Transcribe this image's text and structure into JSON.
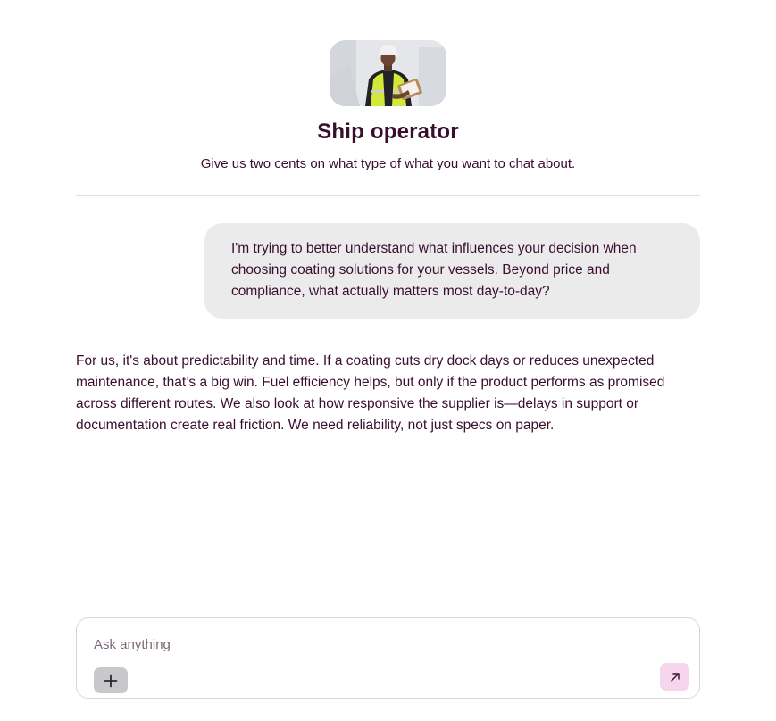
{
  "persona": {
    "name": "Ship operator",
    "description": "Give us two cents on what type of what you want to chat about.",
    "avatar_icon": "ship-operator-photo"
  },
  "conversation": {
    "user_message": "I'm trying to better understand what influences your decision when choosing coating solutions for your vessels. Beyond price and compliance, what actually matters most day-to-day?",
    "assistant_message": "For us, it's about predictability and time. If a coating cuts dry dock days or reduces unexpected maintenance, that’s a big win. Fuel efficiency helps, but only if the product performs as promised across different routes. We also look at how responsive the supplier is—delays in support or documentation create real friction. We need reliability, not just specs on paper."
  },
  "composer": {
    "placeholder": "Ask anything",
    "add_icon": "plus-icon",
    "send_icon": "arrow-up-right-icon"
  },
  "colors": {
    "text": "#3a0f2e",
    "user_bubble": "#ebebec",
    "send_button": "#f6d6ec",
    "add_button": "#c8c8ca"
  }
}
